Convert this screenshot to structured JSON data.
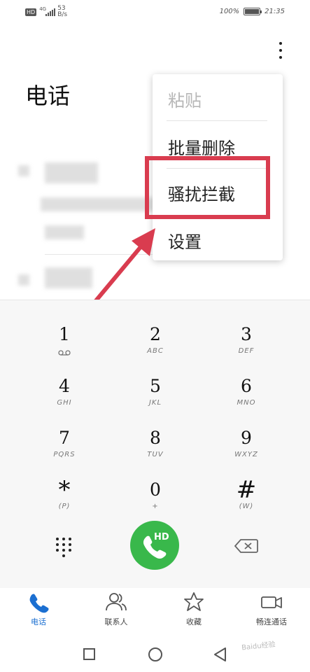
{
  "status_bar": {
    "hd_badge": "HD",
    "network": "4G",
    "speed_value": "53",
    "speed_unit": "B/s",
    "battery": "100%",
    "time": "21:35"
  },
  "header": {
    "title": "电话",
    "more_icon": "more-vertical-icon"
  },
  "menu": {
    "items": [
      {
        "label": "粘贴",
        "enabled": false
      },
      {
        "label": "批量删除",
        "enabled": true
      },
      {
        "label": "骚扰拦截",
        "enabled": true,
        "highlighted": true
      },
      {
        "label": "设置",
        "enabled": true
      }
    ]
  },
  "call_log": {
    "paren": ")"
  },
  "dialpad": {
    "keys": [
      {
        "digit": "1",
        "letters": ""
      },
      {
        "digit": "2",
        "letters": "ABC"
      },
      {
        "digit": "3",
        "letters": "DEF"
      },
      {
        "digit": "4",
        "letters": "GHI"
      },
      {
        "digit": "5",
        "letters": "JKL"
      },
      {
        "digit": "6",
        "letters": "MNO"
      },
      {
        "digit": "7",
        "letters": "PQRS"
      },
      {
        "digit": "8",
        "letters": "TUV"
      },
      {
        "digit": "9",
        "letters": "WXYZ"
      },
      {
        "digit": "*",
        "letters": "(P)"
      },
      {
        "digit": "0",
        "letters": "+"
      },
      {
        "digit": "#",
        "letters": "(W)"
      }
    ],
    "call_badge": "HD",
    "call_color": "#39b84b"
  },
  "tabs": [
    {
      "label": "电话",
      "icon": "phone-icon",
      "active": true
    },
    {
      "label": "联系人",
      "icon": "contacts-icon",
      "active": false
    },
    {
      "label": "收藏",
      "icon": "star-icon",
      "active": false
    },
    {
      "label": "畅连通话",
      "icon": "video-call-icon",
      "active": false
    }
  ],
  "watermark": "Baidu经验",
  "colors": {
    "accent": "#1b6fd1",
    "highlight": "#d93c4f",
    "call": "#39b84b"
  }
}
